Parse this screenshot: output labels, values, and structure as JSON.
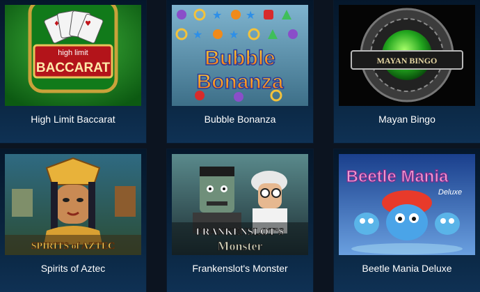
{
  "games": [
    {
      "title": "High Limit Baccarat",
      "art": {
        "line1": "high limit",
        "line2": "BACCARAT"
      }
    },
    {
      "title": "Bubble Bonanza",
      "art": {
        "line1": "Bubble",
        "line2": "Bonanza"
      }
    },
    {
      "title": "Mayan Bingo",
      "art": {
        "line1": "MAYAN BINGO"
      }
    },
    {
      "title": "Spirits of Aztec",
      "art": {
        "line1": "SPIRITS of AZTEC"
      }
    },
    {
      "title": "Frankenslot's Monster",
      "art": {
        "line1": "FRANKENSLOT'S",
        "line2": "Monster"
      }
    },
    {
      "title": "Beetle Mania Deluxe",
      "art": {
        "line1": "Beetle Mania",
        "line2": "Deluxe"
      }
    }
  ],
  "colors": {
    "card_bg": "#0b2844",
    "page_bg": "#0c1420",
    "title_text": "#ffffff"
  }
}
